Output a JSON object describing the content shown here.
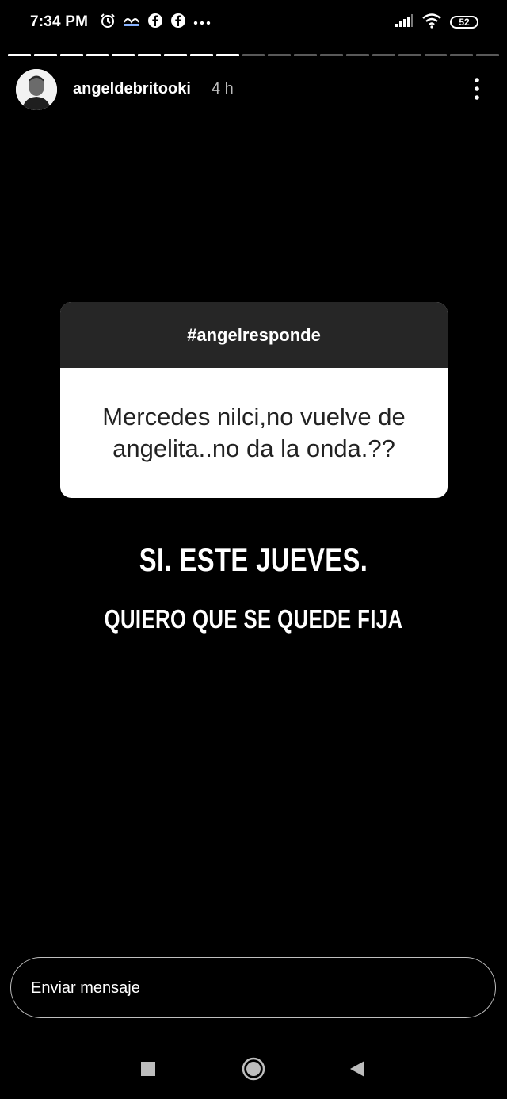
{
  "status_bar": {
    "time": "7:34 PM",
    "left_icons": [
      "alarm-icon",
      "notification-icon",
      "facebook-icon",
      "facebook-icon",
      "more-notifications-icon"
    ],
    "right_icons": [
      "signal-icon",
      "wifi-icon",
      "battery-icon"
    ],
    "battery_level": "52"
  },
  "story": {
    "progress": {
      "total_segments": 19,
      "completed_segments": 9
    },
    "username": "angeldebritooki",
    "time_ago": "4 h"
  },
  "question_sticker": {
    "header": "#angelresponde",
    "question": "Mercedes nilci,no vuelve de angelita..no da la onda.??"
  },
  "answer": {
    "line1": "SI. ESTE JUEVES.",
    "line2": "QUIERO QUE SE QUEDE FIJA"
  },
  "reply": {
    "placeholder": "Enviar mensaje"
  },
  "nav": {
    "items": [
      "recents-button",
      "home-button",
      "back-button"
    ]
  }
}
